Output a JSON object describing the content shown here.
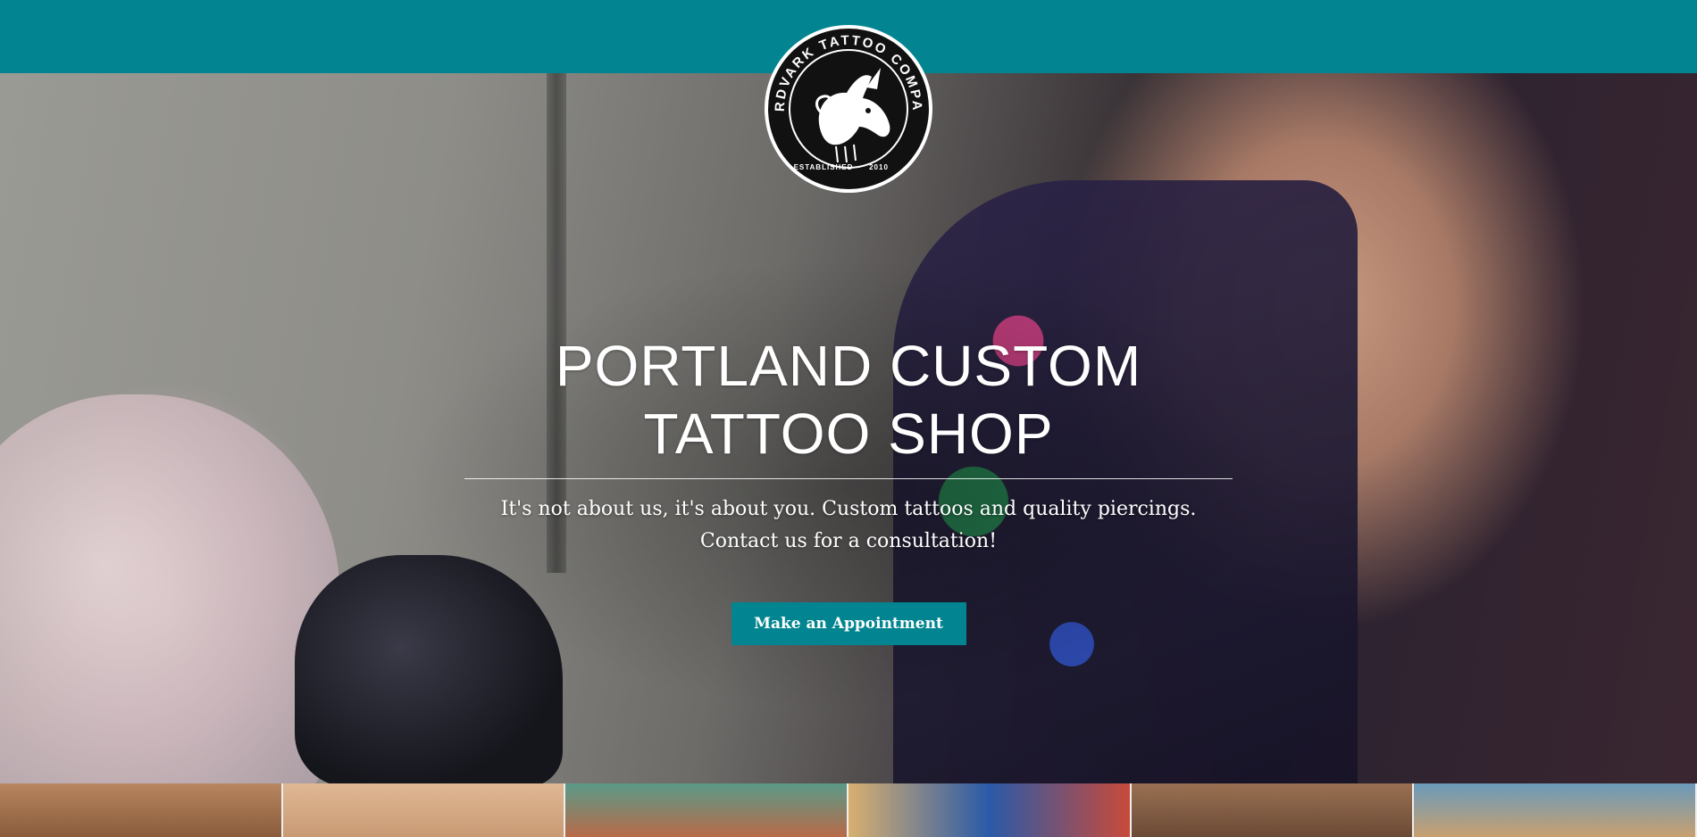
{
  "brand": {
    "logo_text": "AARDVARK TATTOO COMPANY",
    "logo_est_left": "ESTABLISHED",
    "logo_est_right": "2010",
    "accent_color": "#028590"
  },
  "hero": {
    "title_line1": "PORTLAND CUSTOM",
    "title_line2": "TATTOO SHOP",
    "subtitle_line1": "It's not about us, it's about you. Custom tattoos and quality piercings.",
    "subtitle_line2": "Contact us for a consultation!",
    "cta_label": "Make an Appointment"
  },
  "slider": {
    "total": 6,
    "active_index": 0
  },
  "gallery": {
    "tiles": [
      {
        "name": "tattoo-thumbnail-1",
        "color": "#b07a55"
      },
      {
        "name": "tattoo-thumbnail-2",
        "color": "#d4a882"
      },
      {
        "name": "tattoo-thumbnail-3",
        "color": "#3f8a80"
      },
      {
        "name": "tattoo-thumbnail-4",
        "color": "#2a5aa8"
      },
      {
        "name": "tattoo-thumbnail-5",
        "color": "#8a6448"
      },
      {
        "name": "tattoo-thumbnail-6",
        "color": "#4a7a9a"
      }
    ]
  }
}
